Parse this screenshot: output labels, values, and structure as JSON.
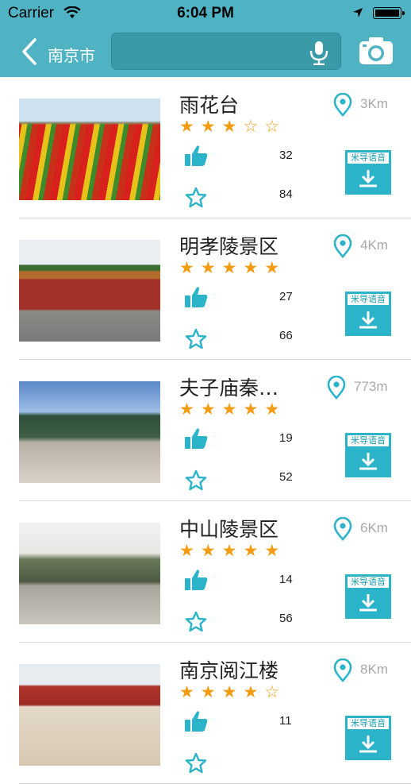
{
  "status_bar": {
    "carrier": "Carrier",
    "time": "6:04 PM"
  },
  "nav": {
    "city": "南京市",
    "search_placeholder": ""
  },
  "colors": {
    "header": "#4fb3c4",
    "accent": "#2ab3c9",
    "star": "#f39c12",
    "like": "#2ab3c9"
  },
  "download_label": "米导语音",
  "items": [
    {
      "name": "雨花台",
      "stars": 3,
      "likes": "32",
      "favorites": "84",
      "distance": "3Km"
    },
    {
      "name": "明孝陵景区",
      "stars": 5,
      "likes": "27",
      "favorites": "66",
      "distance": "4Km"
    },
    {
      "name": "夫子庙秦…",
      "stars": 5,
      "likes": "19",
      "favorites": "52",
      "distance": "773m"
    },
    {
      "name": "中山陵景区",
      "stars": 5,
      "likes": "14",
      "favorites": "56",
      "distance": "6Km"
    },
    {
      "name": "南京阅江楼",
      "stars": 4,
      "likes": "11",
      "favorites": "",
      "distance": "8Km"
    }
  ]
}
